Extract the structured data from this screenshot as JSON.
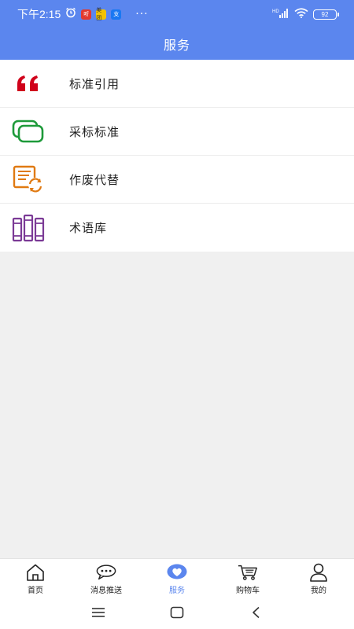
{
  "status_bar": {
    "time": "下午2:15",
    "badge_1": "听",
    "badge_2": "美团",
    "badge_3": "支",
    "more": "···",
    "network": "HD",
    "battery": "92"
  },
  "header": {
    "title": "服务"
  },
  "services": [
    {
      "label": "标准引用",
      "icon": "quote-icon",
      "color": "#d0021b"
    },
    {
      "label": "采标标准",
      "icon": "stacked-frames-icon",
      "color": "#1e9a3a"
    },
    {
      "label": "作废代替",
      "icon": "document-refresh-icon",
      "color": "#e07a12"
    },
    {
      "label": "术语库",
      "icon": "books-icon",
      "color": "#7b3a96"
    }
  ],
  "tabs": [
    {
      "label": "首页",
      "icon": "home-icon",
      "active": false
    },
    {
      "label": "消息推送",
      "icon": "chat-bubble-icon",
      "active": false
    },
    {
      "label": "服务",
      "icon": "heart-icon",
      "active": true
    },
    {
      "label": "购物车",
      "icon": "cart-icon",
      "active": false
    },
    {
      "label": "我的",
      "icon": "user-icon",
      "active": false
    }
  ],
  "colors": {
    "header_bg": "#5b86ee",
    "active_tab": "#5b86ee"
  }
}
